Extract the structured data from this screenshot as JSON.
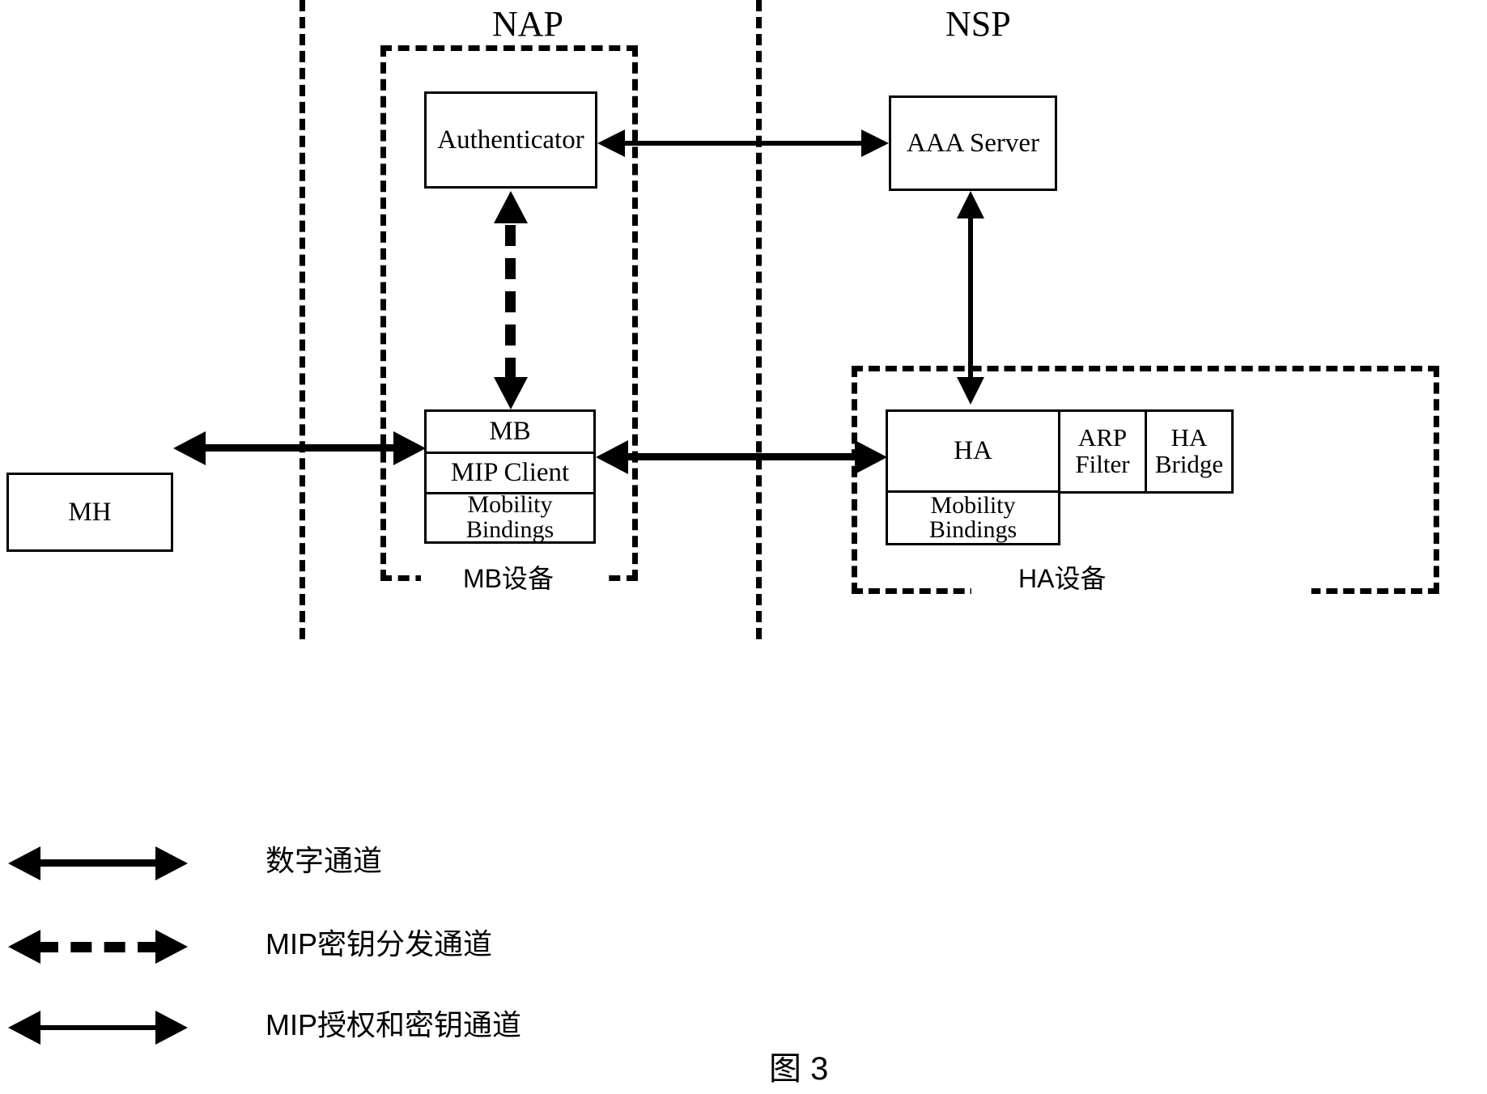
{
  "figure": {
    "caption": "图 3",
    "regions": [
      {
        "id": "nap",
        "label": "NAP"
      },
      {
        "id": "nsp",
        "label": "NSP"
      }
    ]
  },
  "nodes": {
    "mh": {
      "label": "MH"
    },
    "authenticator": {
      "label": "Authenticator"
    },
    "aaa_server": {
      "label": "AAA Server"
    },
    "mb": {
      "title": "MB",
      "rows": [
        {
          "label": "MIP Client"
        },
        {
          "line1": "Mobility",
          "line2": "Bindings"
        }
      ]
    },
    "ha": {
      "title": "HA",
      "rows": [
        {
          "line1": "Mobility",
          "line2": "Bindings"
        }
      ],
      "modules": [
        {
          "line1": "ARP",
          "line2": "Filter"
        },
        {
          "line1": "HA",
          "line2": "Bridge"
        }
      ]
    }
  },
  "enclosures": {
    "mb_device": {
      "caption": "MB设备"
    },
    "ha_device": {
      "caption": "HA设备"
    }
  },
  "legend": {
    "items": [
      {
        "style": "thick-solid-double-arrow",
        "label": "数字通道"
      },
      {
        "style": "thick-dashed-double-arrow",
        "label": "MIP密钥分发通道"
      },
      {
        "style": "thin-solid-double-arrow",
        "label": "MIP授权和密钥通道"
      }
    ]
  },
  "colors": {
    "ink": "#000000",
    "paper": "#ffffff"
  }
}
